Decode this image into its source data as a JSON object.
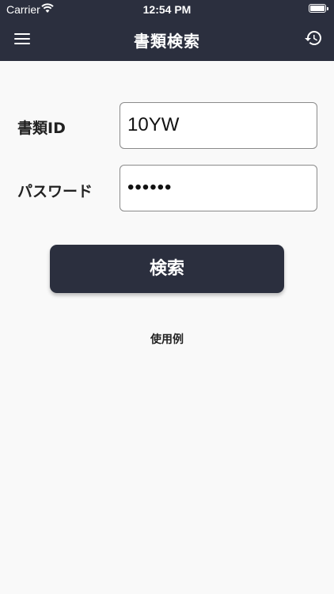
{
  "status_bar": {
    "carrier": "Carrier",
    "time": "12:54 PM",
    "battery_level": 1.0
  },
  "nav": {
    "title": "書類検索",
    "left_icon": "menu-icon",
    "right_icon": "history-icon"
  },
  "form": {
    "document_id_label": "書類ID",
    "document_id_value": "10YW",
    "password_label": "パスワード",
    "password_value": "••••••"
  },
  "search_button_label": "検索",
  "example_link_label": "使用例",
  "colors": {
    "nav_background": "#2b2f3e",
    "page_background": "#f9f9f9",
    "button_background": "#2b2f3e",
    "button_text": "#ffffff"
  }
}
